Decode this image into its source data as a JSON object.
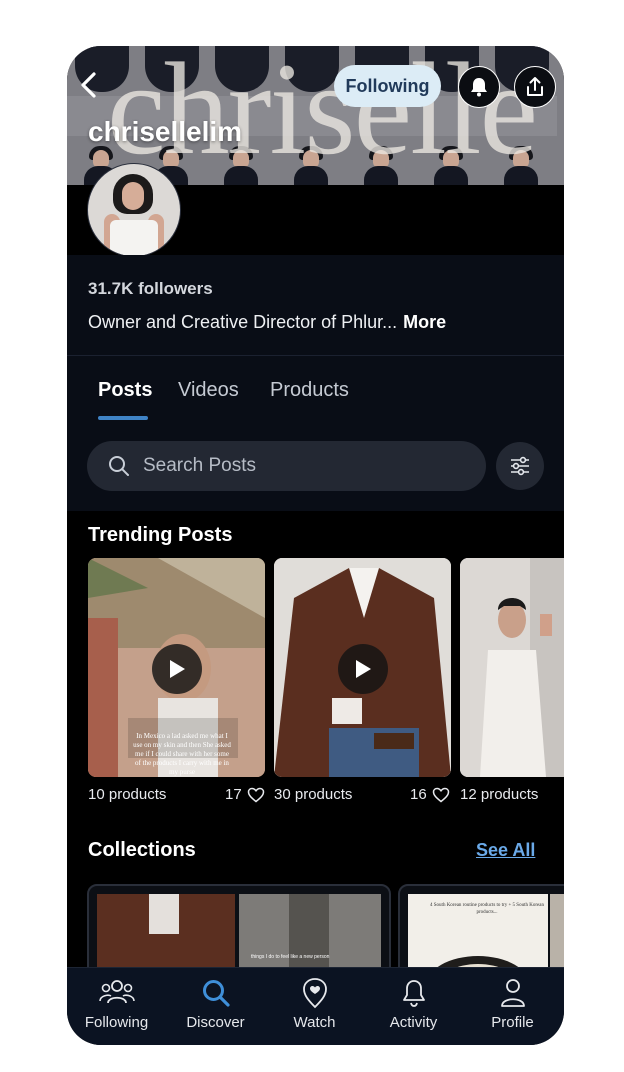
{
  "header": {
    "banner_wordmark": "chriselle",
    "username": "chrisellelim",
    "following_label": "Following",
    "bell_icon": "bell-icon",
    "share_icon": "share-upload-icon",
    "back_icon": "chevron-left-icon"
  },
  "profile": {
    "followers": "31.7K followers",
    "bio": "Owner and Creative Director of Phlur...",
    "more_label": "More"
  },
  "tabs": [
    {
      "label": "Posts",
      "active": true
    },
    {
      "label": "Videos",
      "active": false
    },
    {
      "label": "Products",
      "active": false
    }
  ],
  "search": {
    "placeholder": "Search Posts",
    "filter_icon": "sliders-icon"
  },
  "trending": {
    "title": "Trending Posts",
    "posts": [
      {
        "products": "10 products",
        "likes": "17",
        "overlay_text": "In Mexico a lad asked me what I use on my skin and then She asked me if I could share with her some of the products I carry with me in my purse"
      },
      {
        "products": "30 products",
        "likes": "16"
      },
      {
        "products": "12 products",
        "likes": ""
      }
    ]
  },
  "collections": {
    "title": "Collections",
    "see_all_label": "See All",
    "items": [
      {
        "caption": "things I do to feel like a new person"
      },
      {
        "caption": "4 South Korean routine products to try + 5 South Korean products..."
      }
    ]
  },
  "bottom_nav": [
    {
      "label": "Following",
      "icon": "people-icon",
      "active": false
    },
    {
      "label": "Discover",
      "icon": "search-icon",
      "active": true
    },
    {
      "label": "Watch",
      "icon": "heart-pin-icon",
      "active": false
    },
    {
      "label": "Activity",
      "icon": "bell-icon",
      "active": false
    },
    {
      "label": "Profile",
      "icon": "person-icon",
      "active": false
    }
  ],
  "colors": {
    "accent": "#3f83c6",
    "following_bg": "#dcecf6",
    "background": "#000000",
    "surface": "#090d16",
    "nav_bg": "#0b1322"
  }
}
